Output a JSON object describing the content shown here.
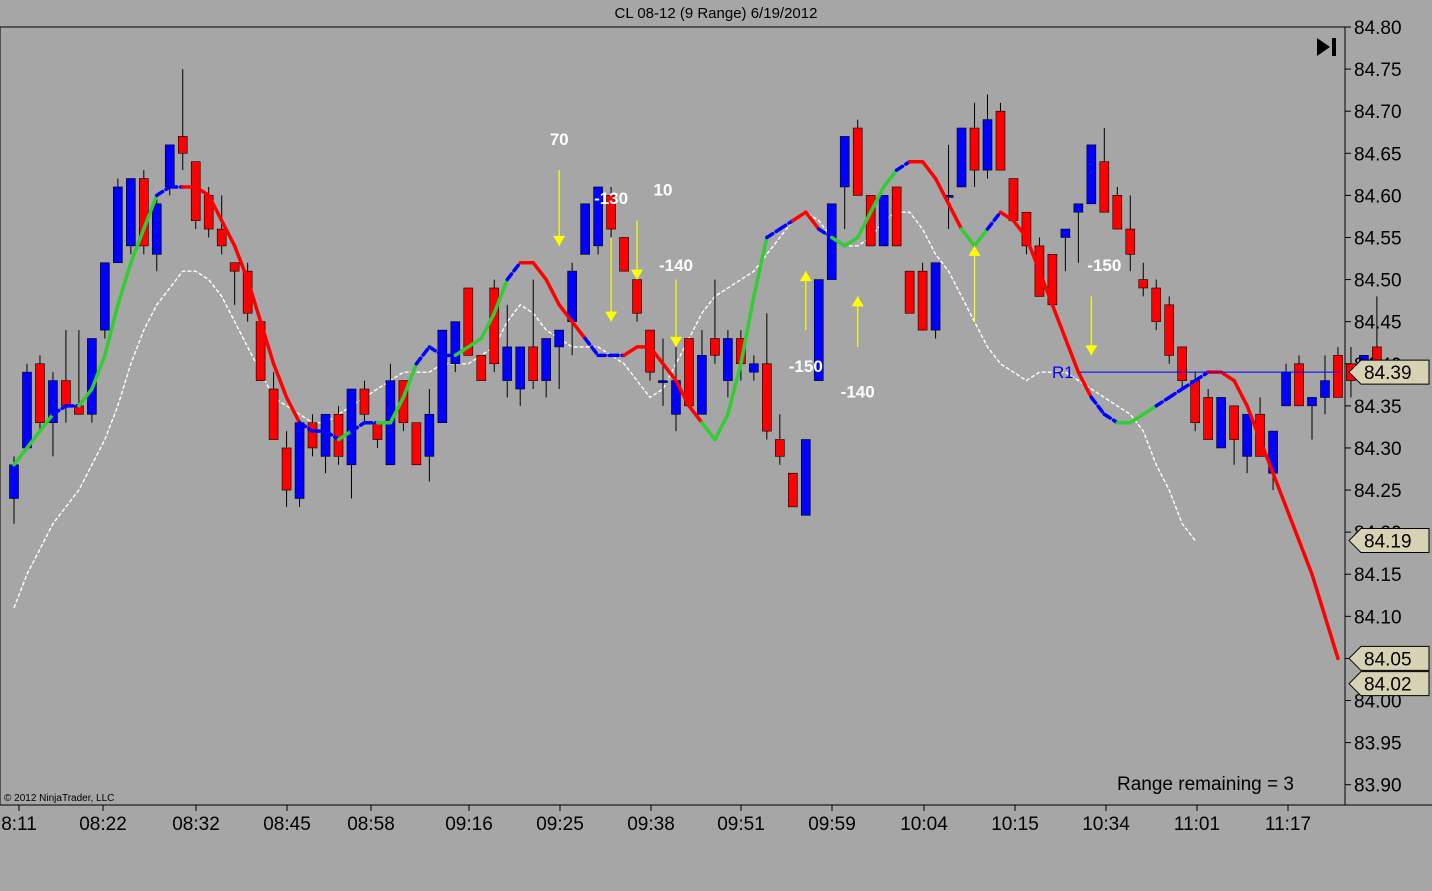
{
  "title": "CL 08-12 (9 Range)  6/19/2012",
  "copyright": "© 2012 NinjaTrader, LLC",
  "range_remaining": "Range remaining = 3",
  "colors": {
    "background": "#a6a6a6",
    "up_bar": "#0000ff",
    "down_bar": "#ff0000",
    "ma_rising": "#32cd32",
    "ma_falling": "#ff0000",
    "ma_flat": "#0000ff",
    "slow_ma": "#ffffff",
    "arrows": "#ffff00",
    "price_line": "#0000ff",
    "tag_fill": "#d8d2b4"
  },
  "icons": {
    "scroll_end": "skip-to-end-icon"
  },
  "chart_data": {
    "type": "candlestick",
    "ylim": [
      83.88,
      84.8
    ],
    "yticks": [
      "84.80",
      "84.75",
      "84.70",
      "84.65",
      "84.60",
      "84.55",
      "84.50",
      "84.45",
      "84.40",
      "84.35",
      "84.30",
      "84.25",
      "84.20",
      "84.15",
      "84.10",
      "84.05",
      "84.00",
      "83.95",
      "83.90"
    ],
    "xticks": [
      {
        "bar": 0,
        "label": "8:11"
      },
      {
        "bar": 7,
        "label": "08:22"
      },
      {
        "bar": 14,
        "label": "08:32"
      },
      {
        "bar": 21,
        "label": "08:45"
      },
      {
        "bar": 28,
        "label": "08:58"
      },
      {
        "bar": 35,
        "label": "09:16"
      },
      {
        "bar": 42,
        "label": "09:25"
      },
      {
        "bar": 49,
        "label": "09:38"
      },
      {
        "bar": 56,
        "label": "09:51"
      },
      {
        "bar": 63,
        "label": "09:59"
      },
      {
        "bar": 70,
        "label": "10:04"
      },
      {
        "bar": 77,
        "label": "10:15"
      },
      {
        "bar": 84,
        "label": "10:34"
      },
      {
        "bar": 91,
        "label": "11:01"
      },
      {
        "bar": 98,
        "label": "11:17"
      }
    ],
    "bars": [
      {
        "o": 84.24,
        "h": 84.29,
        "l": 84.21,
        "c": 84.28
      },
      {
        "o": 84.3,
        "h": 84.4,
        "l": 84.3,
        "c": 84.39
      },
      {
        "o": 84.4,
        "h": 84.41,
        "l": 84.32,
        "c": 84.33
      },
      {
        "o": 84.33,
        "h": 84.39,
        "l": 84.29,
        "c": 84.38
      },
      {
        "o": 84.38,
        "h": 84.44,
        "l": 84.33,
        "c": 84.35
      },
      {
        "o": 84.35,
        "h": 84.44,
        "l": 84.34,
        "c": 84.34
      },
      {
        "o": 84.34,
        "h": 84.43,
        "l": 84.33,
        "c": 84.43
      },
      {
        "o": 84.44,
        "h": 84.52,
        "l": 84.43,
        "c": 84.52
      },
      {
        "o": 84.52,
        "h": 84.62,
        "l": 84.52,
        "c": 84.61
      },
      {
        "o": 84.54,
        "h": 84.62,
        "l": 84.53,
        "c": 84.62
      },
      {
        "o": 84.62,
        "h": 84.63,
        "l": 84.53,
        "c": 84.54
      },
      {
        "o": 84.53,
        "h": 84.6,
        "l": 84.51,
        "c": 84.59
      },
      {
        "o": 84.61,
        "h": 84.66,
        "l": 84.6,
        "c": 84.66
      },
      {
        "o": 84.67,
        "h": 84.75,
        "l": 84.63,
        "c": 84.65
      },
      {
        "o": 84.64,
        "h": 84.64,
        "l": 84.56,
        "c": 84.57
      },
      {
        "o": 84.6,
        "h": 84.61,
        "l": 84.55,
        "c": 84.56
      },
      {
        "o": 84.56,
        "h": 84.6,
        "l": 84.53,
        "c": 84.54
      },
      {
        "o": 84.52,
        "h": 84.52,
        "l": 84.47,
        "c": 84.51
      },
      {
        "o": 84.51,
        "h": 84.52,
        "l": 84.45,
        "c": 84.46
      },
      {
        "o": 84.45,
        "h": 84.45,
        "l": 84.38,
        "c": 84.38
      },
      {
        "o": 84.37,
        "h": 84.39,
        "l": 84.31,
        "c": 84.31
      },
      {
        "o": 84.3,
        "h": 84.32,
        "l": 84.23,
        "c": 84.25
      },
      {
        "o": 84.24,
        "h": 84.33,
        "l": 84.23,
        "c": 84.33
      },
      {
        "o": 84.33,
        "h": 84.34,
        "l": 84.29,
        "c": 84.3
      },
      {
        "o": 84.29,
        "h": 84.34,
        "l": 84.27,
        "c": 84.34
      },
      {
        "o": 84.34,
        "h": 84.35,
        "l": 84.28,
        "c": 84.29
      },
      {
        "o": 84.28,
        "h": 84.37,
        "l": 84.24,
        "c": 84.37
      },
      {
        "o": 84.37,
        "h": 84.38,
        "l": 84.33,
        "c": 84.34
      },
      {
        "o": 84.33,
        "h": 84.33,
        "l": 84.3,
        "c": 84.31
      },
      {
        "o": 84.28,
        "h": 84.4,
        "l": 84.28,
        "c": 84.38
      },
      {
        "o": 84.38,
        "h": 84.38,
        "l": 84.32,
        "c": 84.33
      },
      {
        "o": 84.33,
        "h": 84.33,
        "l": 84.28,
        "c": 84.28
      },
      {
        "o": 84.29,
        "h": 84.37,
        "l": 84.26,
        "c": 84.34
      },
      {
        "o": 84.33,
        "h": 84.44,
        "l": 84.33,
        "c": 84.44
      },
      {
        "o": 84.4,
        "h": 84.45,
        "l": 84.39,
        "c": 84.45
      },
      {
        "o": 84.49,
        "h": 84.49,
        "l": 84.41,
        "c": 84.41
      },
      {
        "o": 84.41,
        "h": 84.41,
        "l": 84.38,
        "c": 84.38
      },
      {
        "o": 84.49,
        "h": 84.5,
        "l": 84.39,
        "c": 84.4
      },
      {
        "o": 84.38,
        "h": 84.47,
        "l": 84.36,
        "c": 84.42
      },
      {
        "o": 84.37,
        "h": 84.42,
        "l": 84.35,
        "c": 84.42
      },
      {
        "o": 84.42,
        "h": 84.5,
        "l": 84.37,
        "c": 84.38
      },
      {
        "o": 84.38,
        "h": 84.43,
        "l": 84.36,
        "c": 84.43
      },
      {
        "o": 84.42,
        "h": 84.44,
        "l": 84.37,
        "c": 84.44
      },
      {
        "o": 84.45,
        "h": 84.52,
        "l": 84.41,
        "c": 84.51
      },
      {
        "o": 84.53,
        "h": 84.59,
        "l": 84.53,
        "c": 84.59
      },
      {
        "o": 84.54,
        "h": 84.61,
        "l": 84.53,
        "c": 84.61
      },
      {
        "o": 84.6,
        "h": 84.61,
        "l": 84.55,
        "c": 84.56
      },
      {
        "o": 84.55,
        "h": 84.55,
        "l": 84.51,
        "c": 84.51
      },
      {
        "o": 84.5,
        "h": 84.5,
        "l": 84.45,
        "c": 84.46
      },
      {
        "o": 84.44,
        "h": 84.44,
        "l": 84.38,
        "c": 84.39
      },
      {
        "o": 84.38,
        "h": 84.43,
        "l": 84.35,
        "c": 84.38
      },
      {
        "o": 84.34,
        "h": 84.43,
        "l": 84.32,
        "c": 84.38
      },
      {
        "o": 84.43,
        "h": 84.43,
        "l": 84.35,
        "c": 84.35
      },
      {
        "o": 84.34,
        "h": 84.44,
        "l": 84.34,
        "c": 84.41
      },
      {
        "o": 84.43,
        "h": 84.5,
        "l": 84.4,
        "c": 84.41
      },
      {
        "o": 84.38,
        "h": 84.44,
        "l": 84.36,
        "c": 84.43
      },
      {
        "o": 84.43,
        "h": 84.44,
        "l": 84.38,
        "c": 84.4
      },
      {
        "o": 84.39,
        "h": 84.41,
        "l": 84.38,
        "c": 84.4
      },
      {
        "o": 84.4,
        "h": 84.46,
        "l": 84.31,
        "c": 84.32
      },
      {
        "o": 84.31,
        "h": 84.34,
        "l": 84.28,
        "c": 84.29
      },
      {
        "o": 84.27,
        "h": 84.27,
        "l": 84.23,
        "c": 84.23
      },
      {
        "o": 84.22,
        "h": 84.31,
        "l": 84.22,
        "c": 84.31
      },
      {
        "o": 84.38,
        "h": 84.5,
        "l": 84.38,
        "c": 84.5
      },
      {
        "o": 84.5,
        "h": 84.59,
        "l": 84.5,
        "c": 84.59
      },
      {
        "o": 84.61,
        "h": 84.67,
        "l": 84.56,
        "c": 84.67
      },
      {
        "o": 84.68,
        "h": 84.69,
        "l": 84.6,
        "c": 84.6
      },
      {
        "o": 84.6,
        "h": 84.6,
        "l": 84.54,
        "c": 84.54
      },
      {
        "o": 84.54,
        "h": 84.6,
        "l": 84.54,
        "c": 84.6
      },
      {
        "o": 84.61,
        "h": 84.61,
        "l": 84.54,
        "c": 84.54
      },
      {
        "o": 84.51,
        "h": 84.51,
        "l": 84.46,
        "c": 84.46
      },
      {
        "o": 84.51,
        "h": 84.52,
        "l": 84.44,
        "c": 84.44
      },
      {
        "o": 84.44,
        "h": 84.52,
        "l": 84.43,
        "c": 84.52
      },
      {
        "o": 84.6,
        "h": 84.66,
        "l": 84.56,
        "c": 84.6
      },
      {
        "o": 84.61,
        "h": 84.68,
        "l": 84.61,
        "c": 84.68
      },
      {
        "o": 84.68,
        "h": 84.71,
        "l": 84.61,
        "c": 84.63
      },
      {
        "o": 84.63,
        "h": 84.72,
        "l": 84.62,
        "c": 84.69
      },
      {
        "o": 84.7,
        "h": 84.71,
        "l": 84.63,
        "c": 84.63
      },
      {
        "o": 84.62,
        "h": 84.62,
        "l": 84.57,
        "c": 84.57
      },
      {
        "o": 84.58,
        "h": 84.58,
        "l": 84.53,
        "c": 84.54
      },
      {
        "o": 84.54,
        "h": 84.55,
        "l": 84.48,
        "c": 84.48
      },
      {
        "o": 84.53,
        "h": 84.53,
        "l": 84.47,
        "c": 84.47
      },
      {
        "o": 84.55,
        "h": 84.56,
        "l": 84.51,
        "c": 84.56
      },
      {
        "o": 84.58,
        "h": 84.58,
        "l": 84.52,
        "c": 84.59
      },
      {
        "o": 84.59,
        "h": 84.66,
        "l": 84.59,
        "c": 84.66
      },
      {
        "o": 84.64,
        "h": 84.68,
        "l": 84.58,
        "c": 84.58
      },
      {
        "o": 84.6,
        "h": 84.61,
        "l": 84.56,
        "c": 84.56
      },
      {
        "o": 84.56,
        "h": 84.6,
        "l": 84.51,
        "c": 84.53
      },
      {
        "o": 84.5,
        "h": 84.52,
        "l": 84.48,
        "c": 84.49
      },
      {
        "o": 84.49,
        "h": 84.5,
        "l": 84.44,
        "c": 84.45
      },
      {
        "o": 84.47,
        "h": 84.48,
        "l": 84.4,
        "c": 84.41
      },
      {
        "o": 84.42,
        "h": 84.42,
        "l": 84.37,
        "c": 84.38
      },
      {
        "o": 84.38,
        "h": 84.39,
        "l": 84.32,
        "c": 84.33
      },
      {
        "o": 84.36,
        "h": 84.37,
        "l": 84.31,
        "c": 84.31
      },
      {
        "o": 84.3,
        "h": 84.36,
        "l": 84.3,
        "c": 84.36
      },
      {
        "o": 84.35,
        "h": 84.35,
        "l": 84.28,
        "c": 84.31
      },
      {
        "o": 84.29,
        "h": 84.34,
        "l": 84.27,
        "c": 84.34
      },
      {
        "o": 84.34,
        "h": 84.36,
        "l": 84.29,
        "c": 84.29
      },
      {
        "o": 84.27,
        "h": 84.3,
        "l": 84.25,
        "c": 84.32
      },
      {
        "o": 84.35,
        "h": 84.4,
        "l": 84.35,
        "c": 84.39
      },
      {
        "o": 84.4,
        "h": 84.41,
        "l": 84.35,
        "c": 84.35
      },
      {
        "o": 84.35,
        "h": 84.36,
        "l": 84.31,
        "c": 84.36
      },
      {
        "o": 84.36,
        "h": 84.41,
        "l": 84.34,
        "c": 84.38
      },
      {
        "o": 84.41,
        "h": 84.42,
        "l": 84.36,
        "c": 84.36
      },
      {
        "o": 84.4,
        "h": 84.42,
        "l": 84.36,
        "c": 84.38
      },
      {
        "o": 84.38,
        "h": 84.41,
        "l": 84.38,
        "c": 84.41
      },
      {
        "o": 84.42,
        "h": 84.48,
        "l": 84.38,
        "c": 84.38
      }
    ],
    "fast_ma": [
      84.28,
      84.3,
      84.32,
      84.34,
      84.35,
      84.35,
      84.37,
      84.41,
      84.47,
      84.52,
      84.56,
      84.6,
      84.61,
      84.61,
      84.61,
      84.6,
      84.57,
      84.54,
      84.5,
      84.45,
      84.4,
      84.36,
      84.33,
      84.32,
      84.32,
      84.31,
      84.32,
      84.33,
      84.33,
      84.33,
      84.36,
      84.4,
      84.42,
      84.41,
      84.41,
      84.42,
      84.43,
      84.46,
      84.5,
      84.52,
      84.52,
      84.5,
      84.47,
      84.45,
      84.43,
      84.41,
      84.41,
      84.41,
      84.42,
      84.42,
      84.4,
      84.38,
      84.35,
      84.33,
      84.31,
      84.34,
      84.4,
      84.48,
      84.55,
      84.56,
      84.57,
      84.58,
      84.56,
      84.55,
      84.54,
      84.55,
      84.58,
      84.61,
      84.63,
      84.64,
      84.64,
      84.62,
      84.59,
      84.56,
      84.54,
      84.56,
      84.58,
      84.57,
      84.55,
      84.51,
      84.47,
      84.43,
      84.39,
      84.36,
      84.34,
      84.33,
      84.33,
      84.34,
      84.35,
      84.36,
      84.37,
      84.38,
      84.39,
      84.39,
      84.38,
      84.35,
      84.31,
      84.27,
      84.23,
      84.19,
      84.15,
      84.1,
      84.05
    ],
    "fast_ma_color": [
      "g",
      "g",
      "g",
      "g",
      "b",
      "b",
      "g",
      "g",
      "g",
      "g",
      "g",
      "g",
      "b",
      "b",
      "r",
      "r",
      "r",
      "r",
      "r",
      "r",
      "r",
      "r",
      "r",
      "b",
      "b",
      "b",
      "g",
      "b",
      "b",
      "g",
      "g",
      "g",
      "b",
      "b",
      "b",
      "g",
      "g",
      "g",
      "g",
      "b",
      "r",
      "r",
      "r",
      "r",
      "r",
      "b",
      "b",
      "b",
      "r",
      "r",
      "r",
      "r",
      "r",
      "r",
      "g",
      "g",
      "g",
      "g",
      "g",
      "b",
      "b",
      "r",
      "r",
      "b",
      "g",
      "g",
      "g",
      "g",
      "g",
      "b",
      "r",
      "r",
      "r",
      "r",
      "g",
      "g",
      "b",
      "r",
      "r",
      "r",
      "r",
      "r",
      "r",
      "r",
      "b",
      "b",
      "g",
      "g",
      "g",
      "b",
      "b",
      "b",
      "b",
      "r",
      "r",
      "r",
      "r",
      "r",
      "r",
      "r",
      "r",
      "r",
      "r"
    ],
    "slow_ma": [
      84.11,
      84.15,
      84.18,
      84.21,
      84.23,
      84.25,
      84.28,
      84.31,
      84.35,
      84.4,
      84.44,
      84.47,
      84.49,
      84.51,
      84.51,
      84.5,
      84.48,
      84.45,
      84.42,
      84.39,
      84.36,
      84.35,
      84.34,
      84.33,
      84.33,
      84.34,
      84.35,
      84.36,
      84.37,
      84.38,
      84.39,
      84.39,
      84.39,
      84.4,
      84.4,
      84.4,
      84.41,
      84.42,
      84.45,
      84.47,
      84.46,
      84.44,
      84.43,
      84.42,
      84.42,
      84.42,
      84.41,
      84.4,
      84.38,
      84.36,
      84.37,
      84.4,
      84.43,
      84.46,
      84.48,
      84.49,
      84.5,
      84.51,
      84.53,
      84.55,
      84.57,
      84.58,
      84.57,
      84.55,
      84.54,
      84.54,
      84.55,
      84.57,
      84.58,
      84.58,
      84.56,
      84.53,
      84.51,
      84.48,
      84.45,
      84.42,
      84.4,
      84.39,
      84.38,
      84.39,
      84.39,
      84.39,
      84.38,
      84.37,
      84.36,
      84.35,
      84.34,
      84.32,
      84.28,
      84.25,
      84.21,
      84.19
    ]
  },
  "annotations": [
    {
      "text": "70",
      "bar": 42,
      "y": 84.66
    },
    {
      "text": "-130",
      "bar": 46,
      "y": 84.59
    },
    {
      "text": "10",
      "bar": 50,
      "y": 84.6
    },
    {
      "text": "-140",
      "bar": 51,
      "y": 84.51
    },
    {
      "text": "-150",
      "bar": 61,
      "y": 84.39
    },
    {
      "text": "-140",
      "bar": 65,
      "y": 84.36
    },
    {
      "text": "-150",
      "bar": 84,
      "y": 84.51
    }
  ],
  "arrows": [
    {
      "dir": "down",
      "bar": 42,
      "from": 84.63,
      "to": 84.54
    },
    {
      "dir": "down",
      "bar": 46,
      "from": 84.55,
      "to": 84.45
    },
    {
      "dir": "down",
      "bar": 48,
      "from": 84.57,
      "to": 84.5
    },
    {
      "dir": "down",
      "bar": 51,
      "from": 84.5,
      "to": 84.42
    },
    {
      "dir": "up",
      "bar": 61,
      "from": 84.44,
      "to": 84.51
    },
    {
      "dir": "up",
      "bar": 65,
      "from": 84.42,
      "to": 84.48
    },
    {
      "dir": "up",
      "bar": 74,
      "from": 84.45,
      "to": 84.54
    },
    {
      "dir": "down",
      "bar": 83,
      "from": 84.48,
      "to": 84.41
    }
  ],
  "price_line": {
    "label": "R1",
    "y": 84.39
  },
  "price_tags": [
    "84.39",
    "84.19",
    "84.05",
    "84.02"
  ]
}
